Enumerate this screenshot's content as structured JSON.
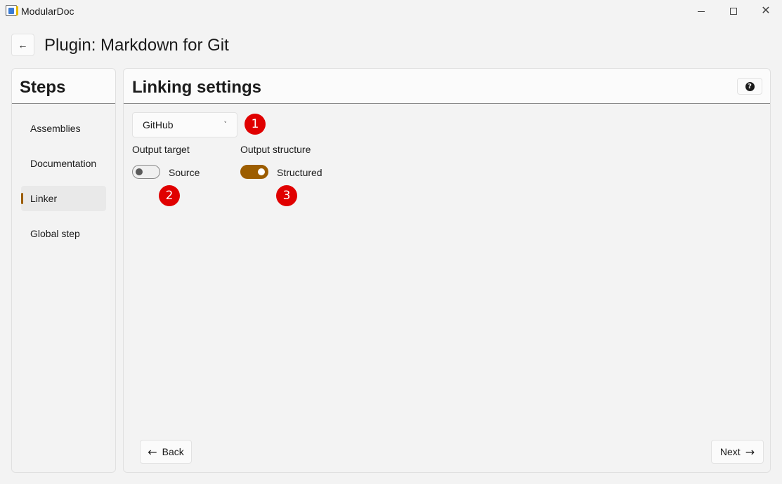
{
  "window": {
    "title": "ModularDoc",
    "icons": {
      "app": "app-icon",
      "minimize": "minimize-icon",
      "maximize": "maximize-icon",
      "close": "close-icon"
    }
  },
  "header": {
    "back_icon": "←",
    "title": "Plugin: Markdown for Git"
  },
  "steps": {
    "title": "Steps",
    "items": [
      {
        "label": "Assemblies",
        "active": false
      },
      {
        "label": "Documentation",
        "active": false
      },
      {
        "label": "Linker",
        "active": true
      },
      {
        "label": "Global step",
        "active": false
      }
    ]
  },
  "main": {
    "title": "Linking settings",
    "help_icon": "?",
    "platform_select": {
      "value": "GitHub",
      "chevron": "˅"
    },
    "output_target": {
      "label": "Output target",
      "toggle_text": "Source",
      "on": false
    },
    "output_structure": {
      "label": "Output structure",
      "toggle_text": "Structured",
      "on": true
    },
    "markers": [
      "1",
      "2",
      "3"
    ],
    "back_button": {
      "icon": "🡠",
      "label": "Back"
    },
    "next_button": {
      "label": "Next",
      "icon": "🡢"
    }
  },
  "colors": {
    "accent": "#9c5d00",
    "marker": "#e00000",
    "background": "#f3f3f3"
  }
}
